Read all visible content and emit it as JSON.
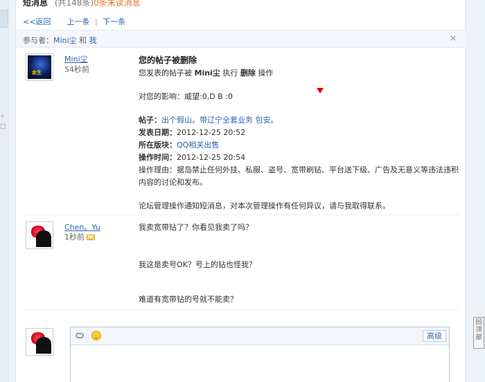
{
  "header": {
    "title": "短消息",
    "count": "(共148条)",
    "unread": "0条未读消息"
  },
  "nav": {
    "back": "<<返回",
    "prev": "上一条",
    "next": "下一条"
  },
  "participants": {
    "label": "参与者：",
    "user1": "Mini尘",
    "and": "和",
    "user2": "我",
    "close": "×"
  },
  "messages": [
    {
      "user": "Mini尘",
      "time": "54秒前",
      "title": "您的帖子被删除",
      "subtitle_prefix": "您发表的帖子被",
      "subtitle_user": "Mini尘",
      "subtitle_mid": "执行",
      "subtitle_action": "删除",
      "subtitle_suffix": "操作",
      "impact": "对您的影响：威望:0,D B :0",
      "post_label": "帖子：",
      "post_value": "出个假山。带辽宁全套业务 包安。",
      "date_label": "发表日期：",
      "date_value": "2012-12-25 20:52",
      "board_label": "所在版块：",
      "board_value": "QQ相关出售",
      "optime_label": "操作时间：",
      "optime_value": "2012-12-25 20:54",
      "reason_label": "操作理由：",
      "reason_value": "操作理由：据岛禁止任何外挂、私服、盗号、宽带刷钻、平台送下级、广告及无意义等违法违积内容的讨论和发布。",
      "footer": "论坛管理操作通知短消息，对本次管理操作有任何异议，请与我取得联系。"
    },
    {
      "user": "Chen。Yu",
      "time": "1秒前",
      "line1": "我卖宽带钻了？你看见我卖了吗？",
      "line2": "我这是卖号OK？号上的钻也怪我？",
      "line3": "难道有宽带钻的号就不能卖？"
    }
  ],
  "editor": {
    "advanced": "高级"
  },
  "back_to_top": "回顶部",
  "avatar1_tag": "余生",
  "colors": {
    "link": "#2b66b1",
    "unread": "#f26c22",
    "marker": "#e00000"
  }
}
